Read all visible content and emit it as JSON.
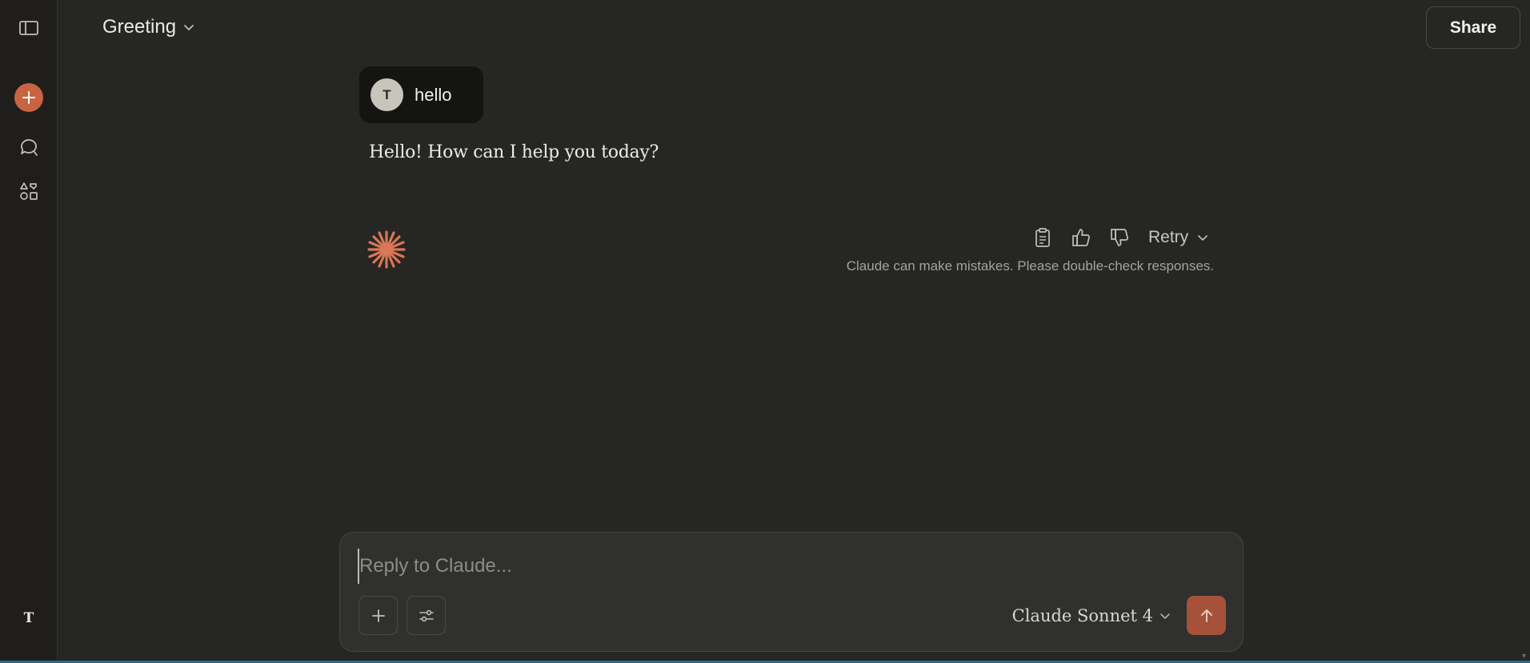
{
  "header": {
    "title": "Greeting",
    "share_label": "Share"
  },
  "sidebar": {
    "user_initial": "T",
    "icons": [
      "sidebar-toggle-icon",
      "new-chat-icon",
      "chats-icon",
      "artifacts-icon"
    ]
  },
  "conversation": {
    "user_avatar_initial": "T",
    "user_message": "hello",
    "assistant_message": "Hello! How can I help you today?",
    "retry_label": "Retry",
    "disclaimer": "Claude can make mistakes. Please double-check responses."
  },
  "composer": {
    "placeholder": "Reply to Claude...",
    "value": "",
    "model_name": "Claude Sonnet 4"
  },
  "colors": {
    "background": "#262624",
    "sidebar": "#1f1e1d",
    "accent": "#c96442",
    "send_button": "#a6513a",
    "user_bubble": "#141413"
  }
}
